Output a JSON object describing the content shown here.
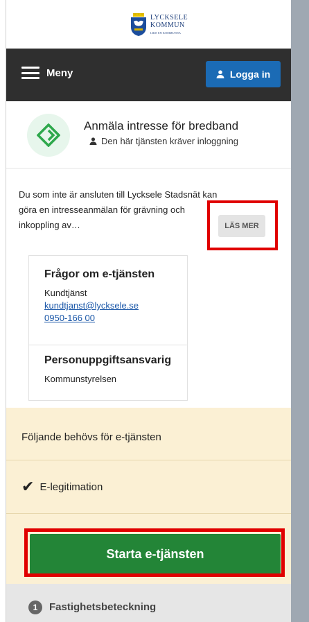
{
  "header": {
    "logo": {
      "line1": "LYCKSELE",
      "line2": "KOMMUN",
      "line3": "LIKE EN KOMMUNNA"
    },
    "menu_label": "Meny",
    "login_label": "Logga in"
  },
  "service": {
    "title": "Anmäla intresse för bredband",
    "login_required": "Den här tjänsten kräver inloggning",
    "description": "Du som inte är ansluten till Lycksele Stadsnät kan göra en intresseanmälan för grävning och inkoppling av…",
    "read_more": "LÄS MER"
  },
  "contact": {
    "questions_heading": "Frågor om e-tjänsten",
    "name": "Kundtjänst",
    "email": "kundtjanst@lycksele.se",
    "phone": "0950-166 00",
    "privacy_heading": "Personuppgiftsansvarig",
    "privacy_org": "Kommunstyrelsen"
  },
  "requirements": {
    "label": "Följande behövs för e-tjänsten",
    "items": [
      {
        "label": "E-legitimation"
      }
    ]
  },
  "start_button": "Starta e-tjänsten",
  "steps": [
    {
      "number": "1",
      "label": "Fastighetsbeteckning"
    }
  ],
  "colors": {
    "navbar": "#2f2f2f",
    "login": "#1b6bb5",
    "start": "#238537",
    "highlight": "#e00000",
    "requirements_bg": "#fbf0d4"
  }
}
